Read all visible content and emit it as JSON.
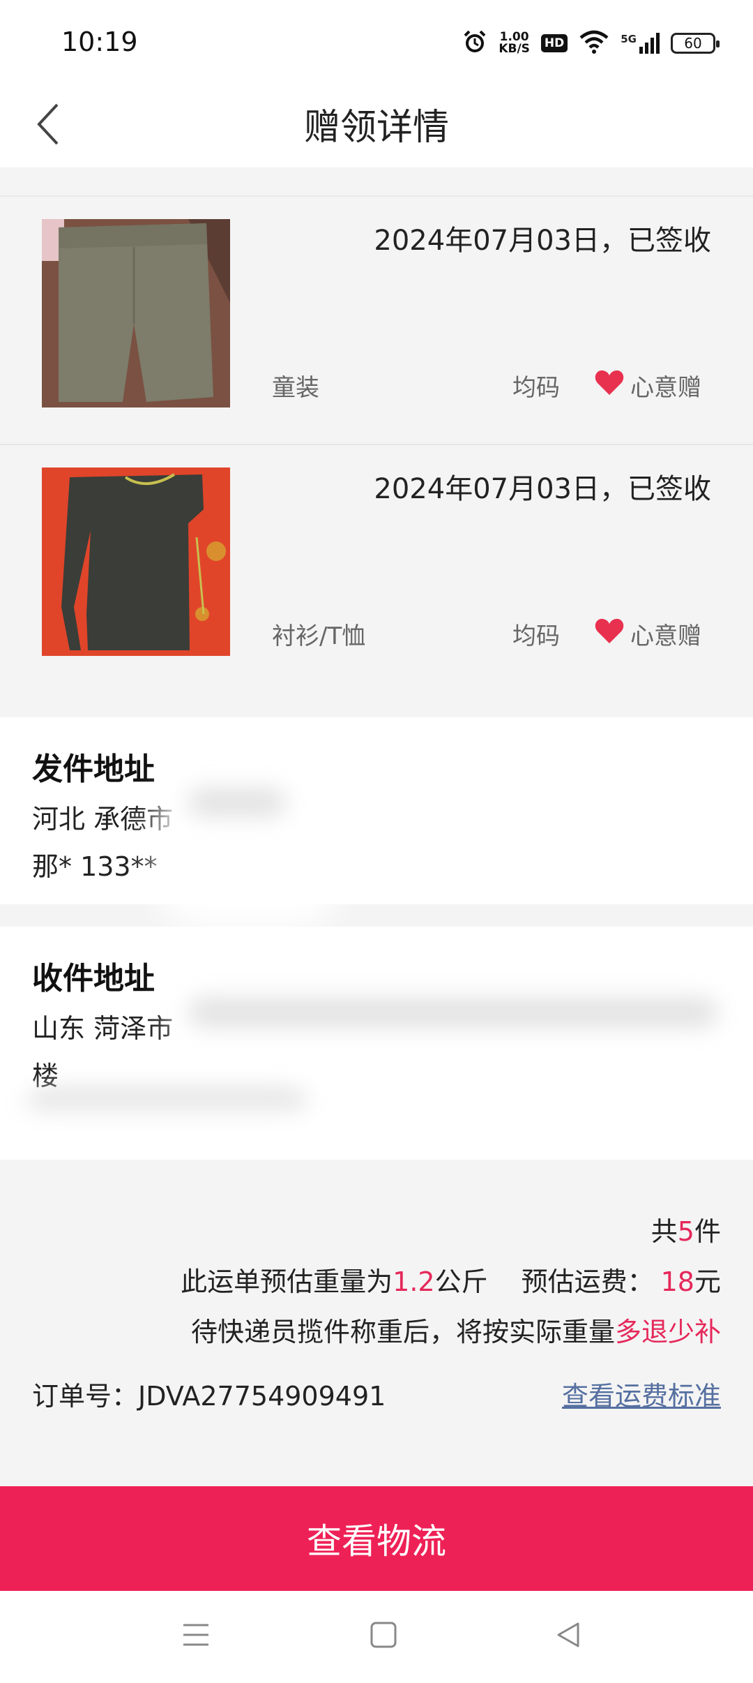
{
  "status": {
    "time": "10:19",
    "speed_value": "1.00",
    "speed_unit": "KB/S",
    "hd": "HD",
    "net": "5G",
    "battery": "60"
  },
  "header": {
    "title": "赠领详情"
  },
  "goods": [
    {
      "status": "2024年07月03日，已签收",
      "category": "童装",
      "size": "均码",
      "gift_label": "心意赠"
    },
    {
      "status": "2024年07月03日，已签收",
      "category": "衬衫/T恤",
      "size": "均码",
      "gift_label": "心意赠"
    }
  ],
  "sender": {
    "title": "发件地址",
    "line1": "河北 承德市",
    "line2": "那* 133**"
  },
  "receiver": {
    "title": "收件地址",
    "line1": "山东 菏泽市",
    "line2": "楼"
  },
  "summary": {
    "count_prefix": "共",
    "count": "5",
    "count_suffix": "件",
    "weight_prefix": "此运单预估重量为",
    "weight": "1.2",
    "weight_unit": "公斤",
    "fee_prefix": "预估运费：",
    "fee": "18",
    "fee_unit": "元",
    "note_prefix": "待快递员揽件称重后，将按实际重量",
    "note_highlight": "多退少补",
    "order_no": "订单号：JDVA27754909491",
    "fee_standard_link": "查看运费标准"
  },
  "actions": {
    "logistics_button": "查看物流"
  },
  "colors": {
    "accent": "#ee2156",
    "highlight": "#e5285a",
    "link": "#556fa0"
  }
}
